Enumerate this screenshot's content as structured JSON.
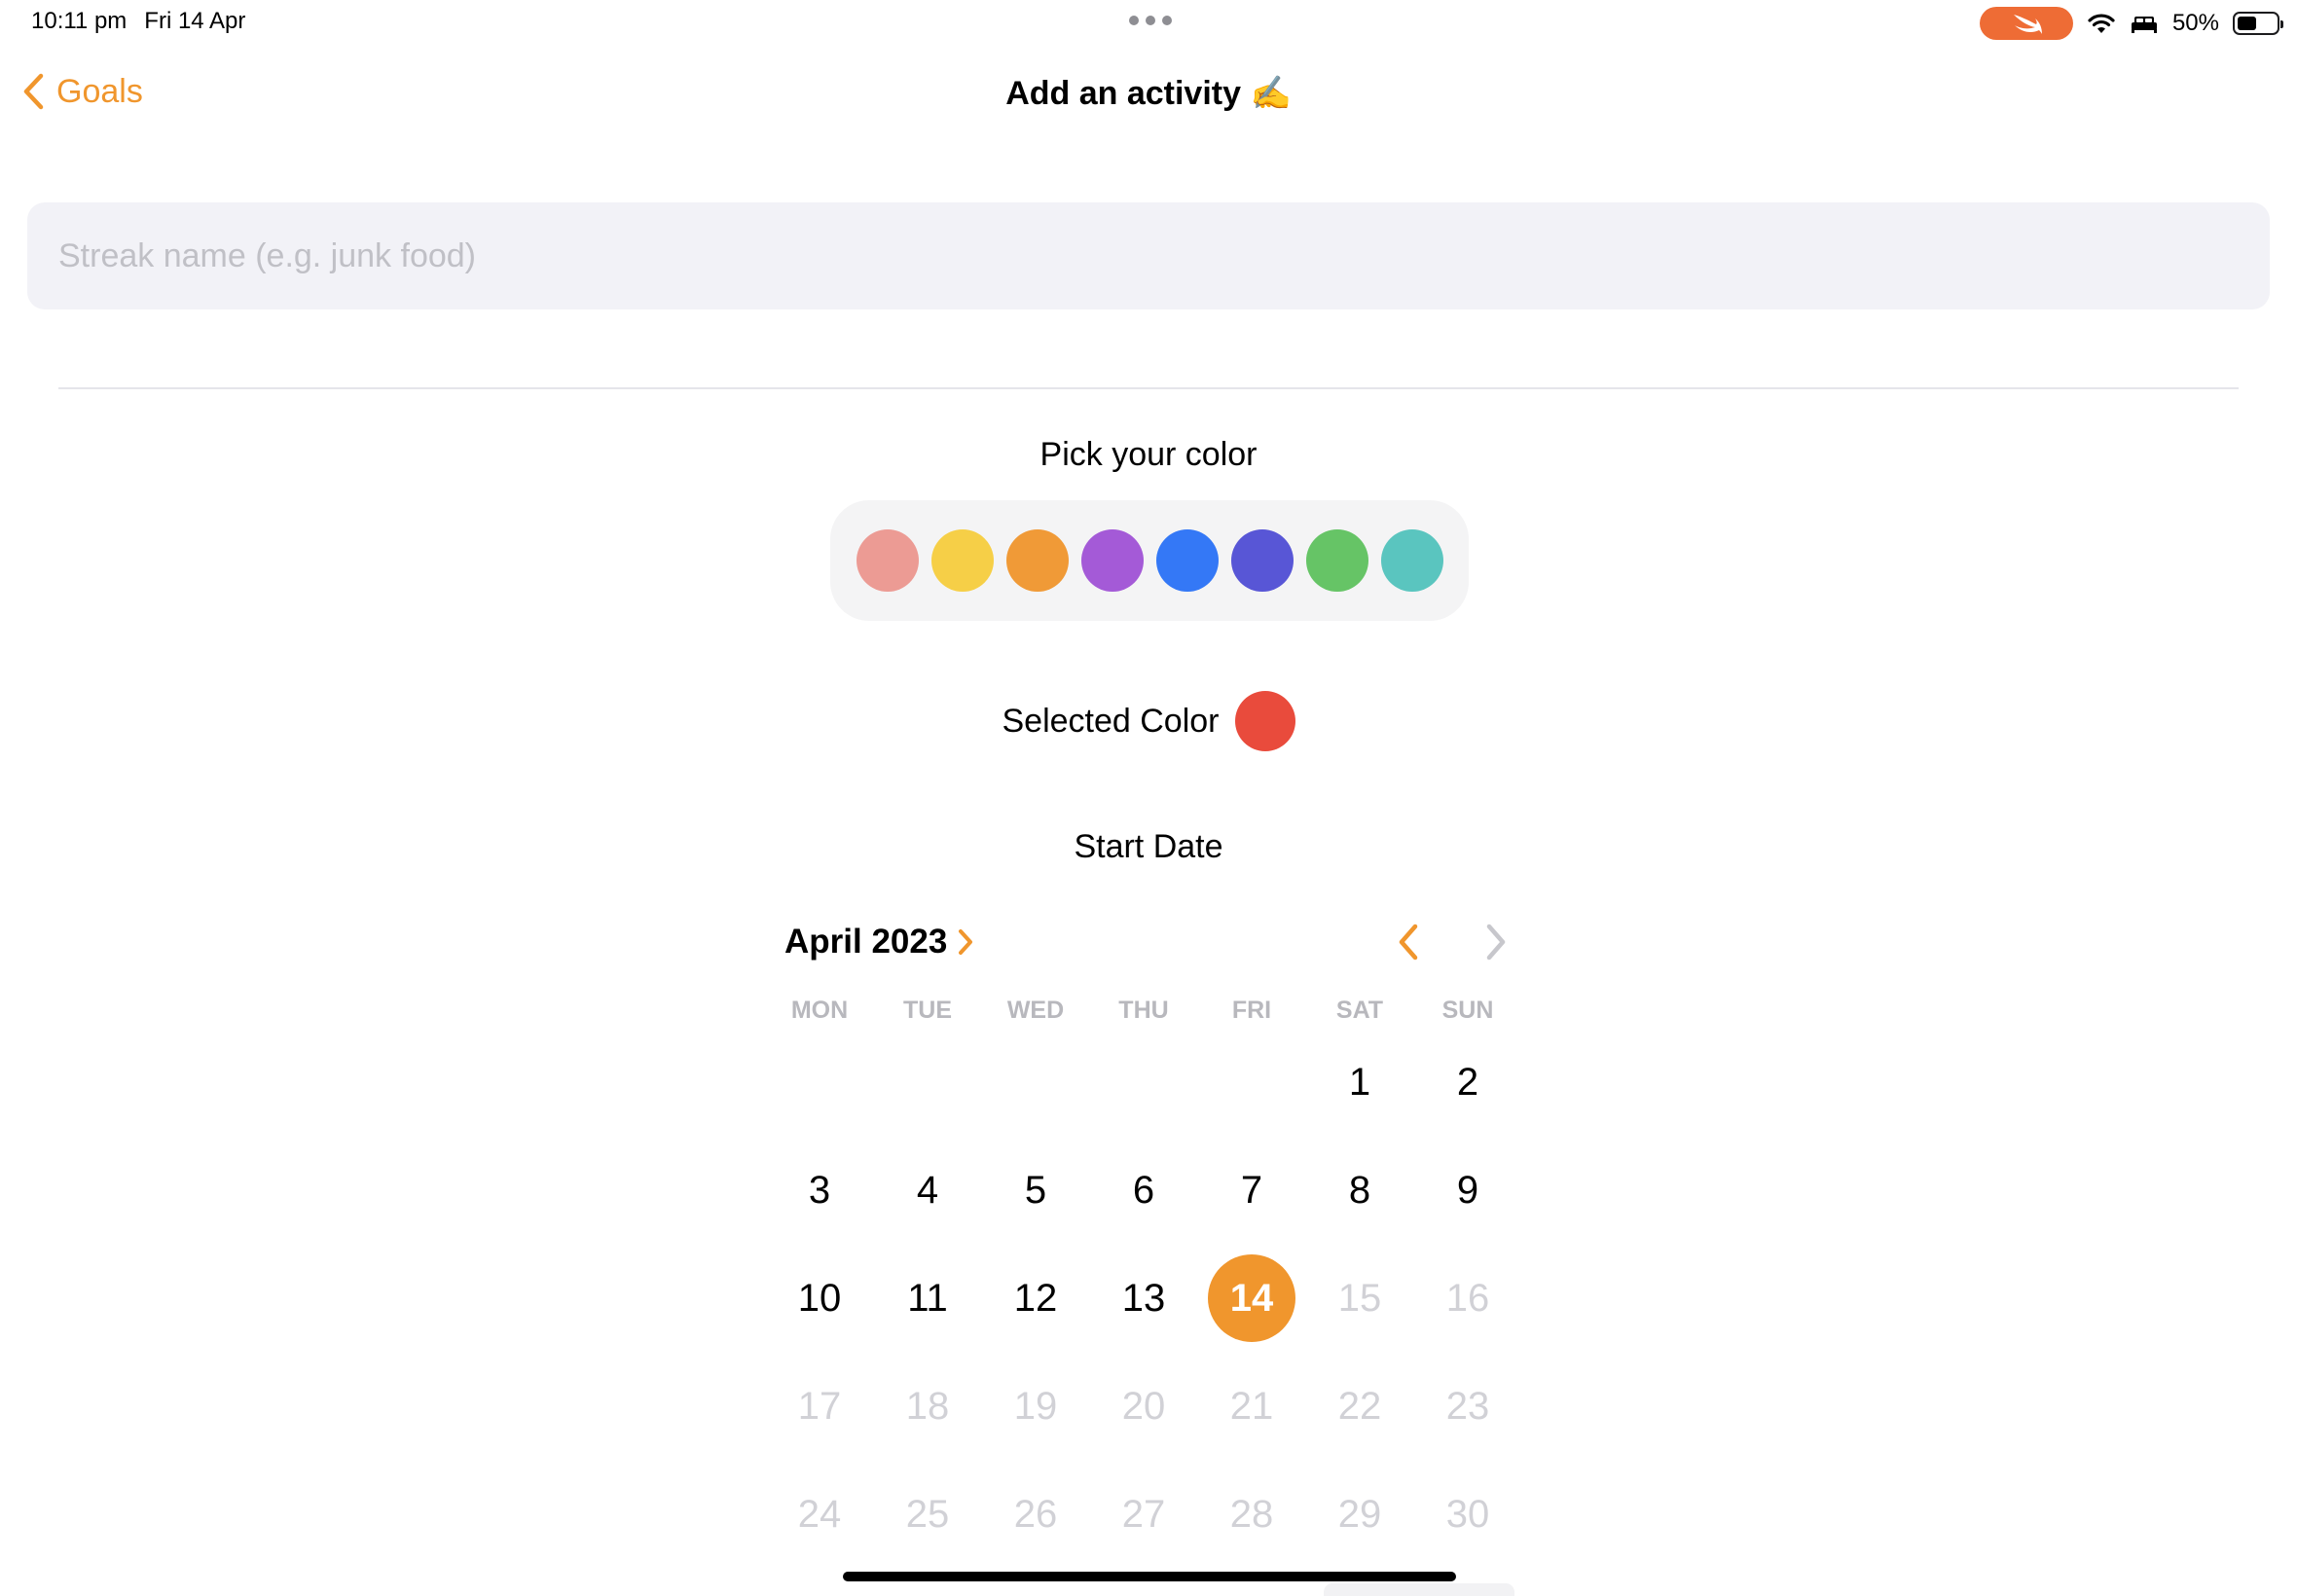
{
  "status_bar": {
    "time": "10:11 pm",
    "date": "Fri 14 Apr",
    "battery": "50%",
    "battery_level": 0.5
  },
  "nav": {
    "back_label": "Goals",
    "title": "Add an activity ✍️"
  },
  "form": {
    "name_placeholder": "Streak name (e.g. junk food)",
    "name_value": ""
  },
  "color_picker": {
    "label": "Pick your color",
    "swatches": [
      "#ec9b94",
      "#f6cf47",
      "#f09a37",
      "#a45ad7",
      "#3478f6",
      "#5856d6",
      "#66c466",
      "#5ac5bf"
    ],
    "selected_label": "Selected Color",
    "selected_color": "#e94b3c"
  },
  "start_date": {
    "label": "Start Date",
    "month_label": "April 2023",
    "weekdays": [
      "MON",
      "TUE",
      "WED",
      "THU",
      "FRI",
      "SAT",
      "SUN"
    ],
    "weeks": [
      [
        "",
        "",
        "",
        "",
        "",
        "1",
        "2"
      ],
      [
        "3",
        "4",
        "5",
        "6",
        "7",
        "8",
        "9"
      ],
      [
        "10",
        "11",
        "12",
        "13",
        "14",
        "15",
        "16"
      ],
      [
        "17",
        "18",
        "19",
        "20",
        "21",
        "22",
        "23"
      ],
      [
        "24",
        "25",
        "26",
        "27",
        "28",
        "29",
        "30"
      ]
    ],
    "selected_day": "14",
    "last_enabled_day": 14
  },
  "colors": {
    "accent": "#f0962d",
    "swift_badge": "#ee6c35"
  }
}
